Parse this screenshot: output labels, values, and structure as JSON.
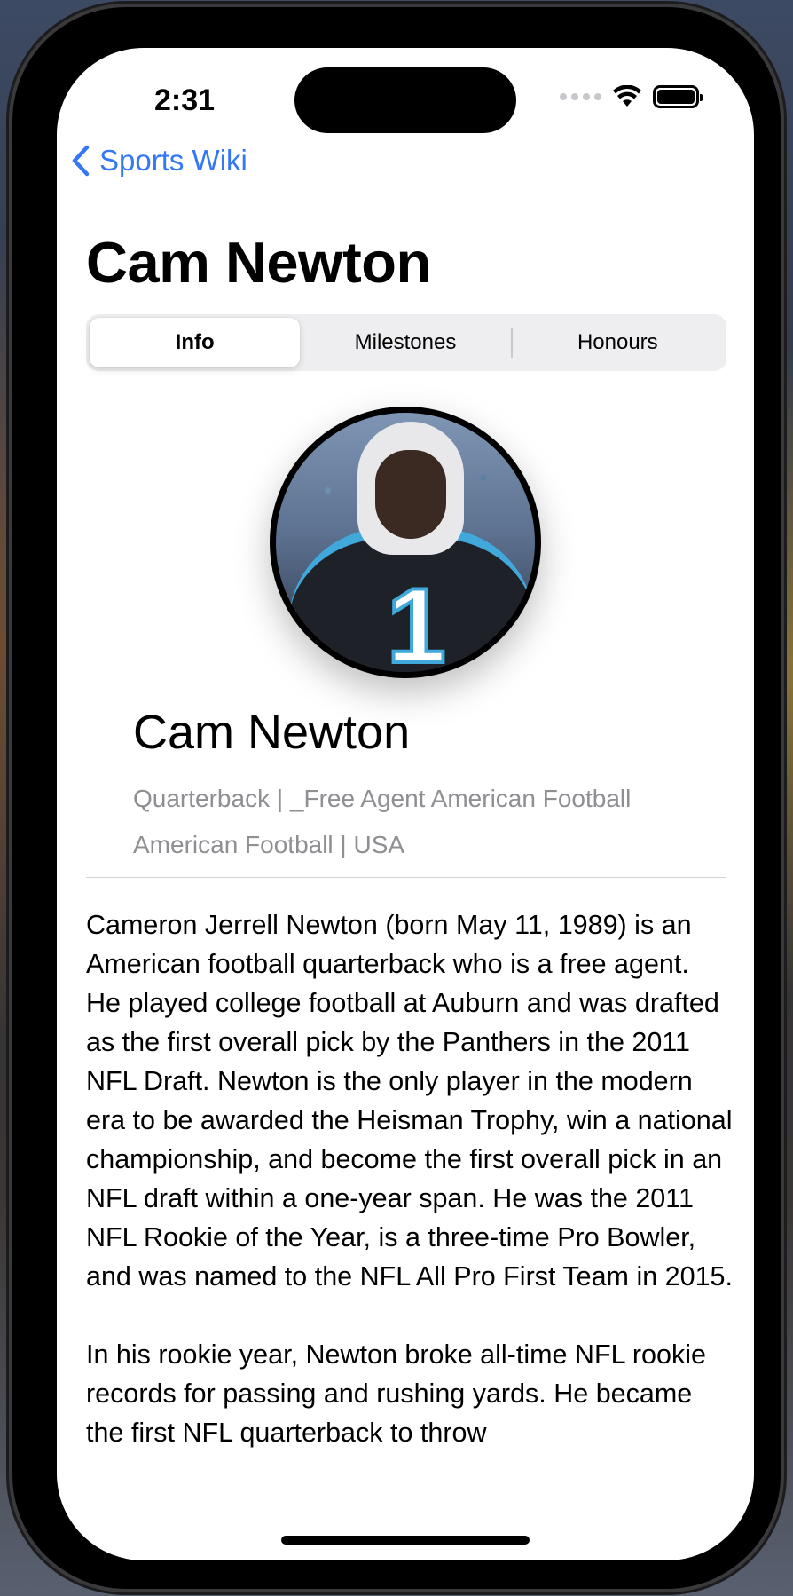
{
  "status": {
    "time": "2:31"
  },
  "nav": {
    "back_label": "Sports Wiki",
    "title": "Cam Newton"
  },
  "tabs": [
    {
      "label": "Info",
      "selected": true
    },
    {
      "label": "Milestones",
      "selected": false
    },
    {
      "label": "Honours",
      "selected": false
    }
  ],
  "player": {
    "name": "Cam Newton",
    "position_team": "Quarterback | _Free Agent American Football",
    "sport_country": "American Football | USA",
    "jersey_number": "1"
  },
  "bio": "Cameron Jerrell Newton (born May 11, 1989) is an American football quarterback who is a free agent.\nHe played college football at Auburn and was drafted as the first overall pick by the Panthers in the 2011 NFL Draft. Newton is the only player in the modern era to be awarded the Heisman Trophy, win a national championship, and become the first overall pick in an NFL draft within a one-year span. He was the 2011 NFL Rookie of the Year, is a three-time Pro Bowler, and was named to the NFL All Pro First Team in 2015.\n\nIn his rookie year, Newton broke all-time NFL rookie records for passing and rushing yards. He became the first NFL quarterback to throw",
  "colors": {
    "accent": "#3478f6",
    "secondary_text": "#8e8e93",
    "jersey_trim": "#41a8dc"
  }
}
